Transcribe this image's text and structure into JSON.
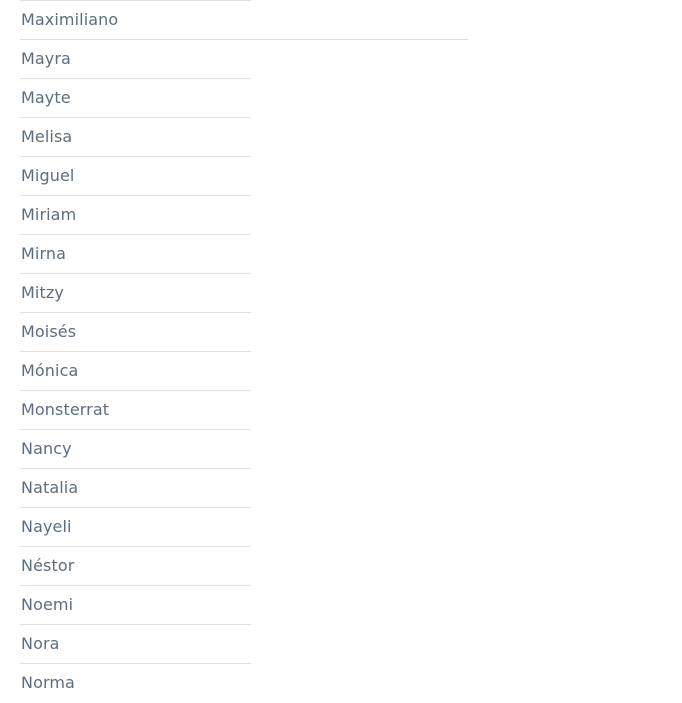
{
  "list": {
    "kind": "alphabetical-name-list",
    "text_color": "#5d6d7e",
    "divider_color": "#e2e2e2",
    "highlight_divider_color": "#dededf",
    "background_color": "#ffffff",
    "items": [
      {
        "name": "Maximiliano"
      },
      {
        "name": "Mayra"
      },
      {
        "name": "Mayte"
      },
      {
        "name": "Melisa"
      },
      {
        "name": "Miguel"
      },
      {
        "name": "Miriam"
      },
      {
        "name": "Mirna"
      },
      {
        "name": "Mitzy"
      },
      {
        "name": "Moisés"
      },
      {
        "name": "Mónica"
      },
      {
        "name": "Monsterrat"
      },
      {
        "name": "Nancy"
      },
      {
        "name": "Natalia"
      },
      {
        "name": "Nayeli"
      },
      {
        "name": "Néstor"
      },
      {
        "name": "Noemi"
      },
      {
        "name": "Nora"
      },
      {
        "name": "Norma"
      }
    ]
  }
}
